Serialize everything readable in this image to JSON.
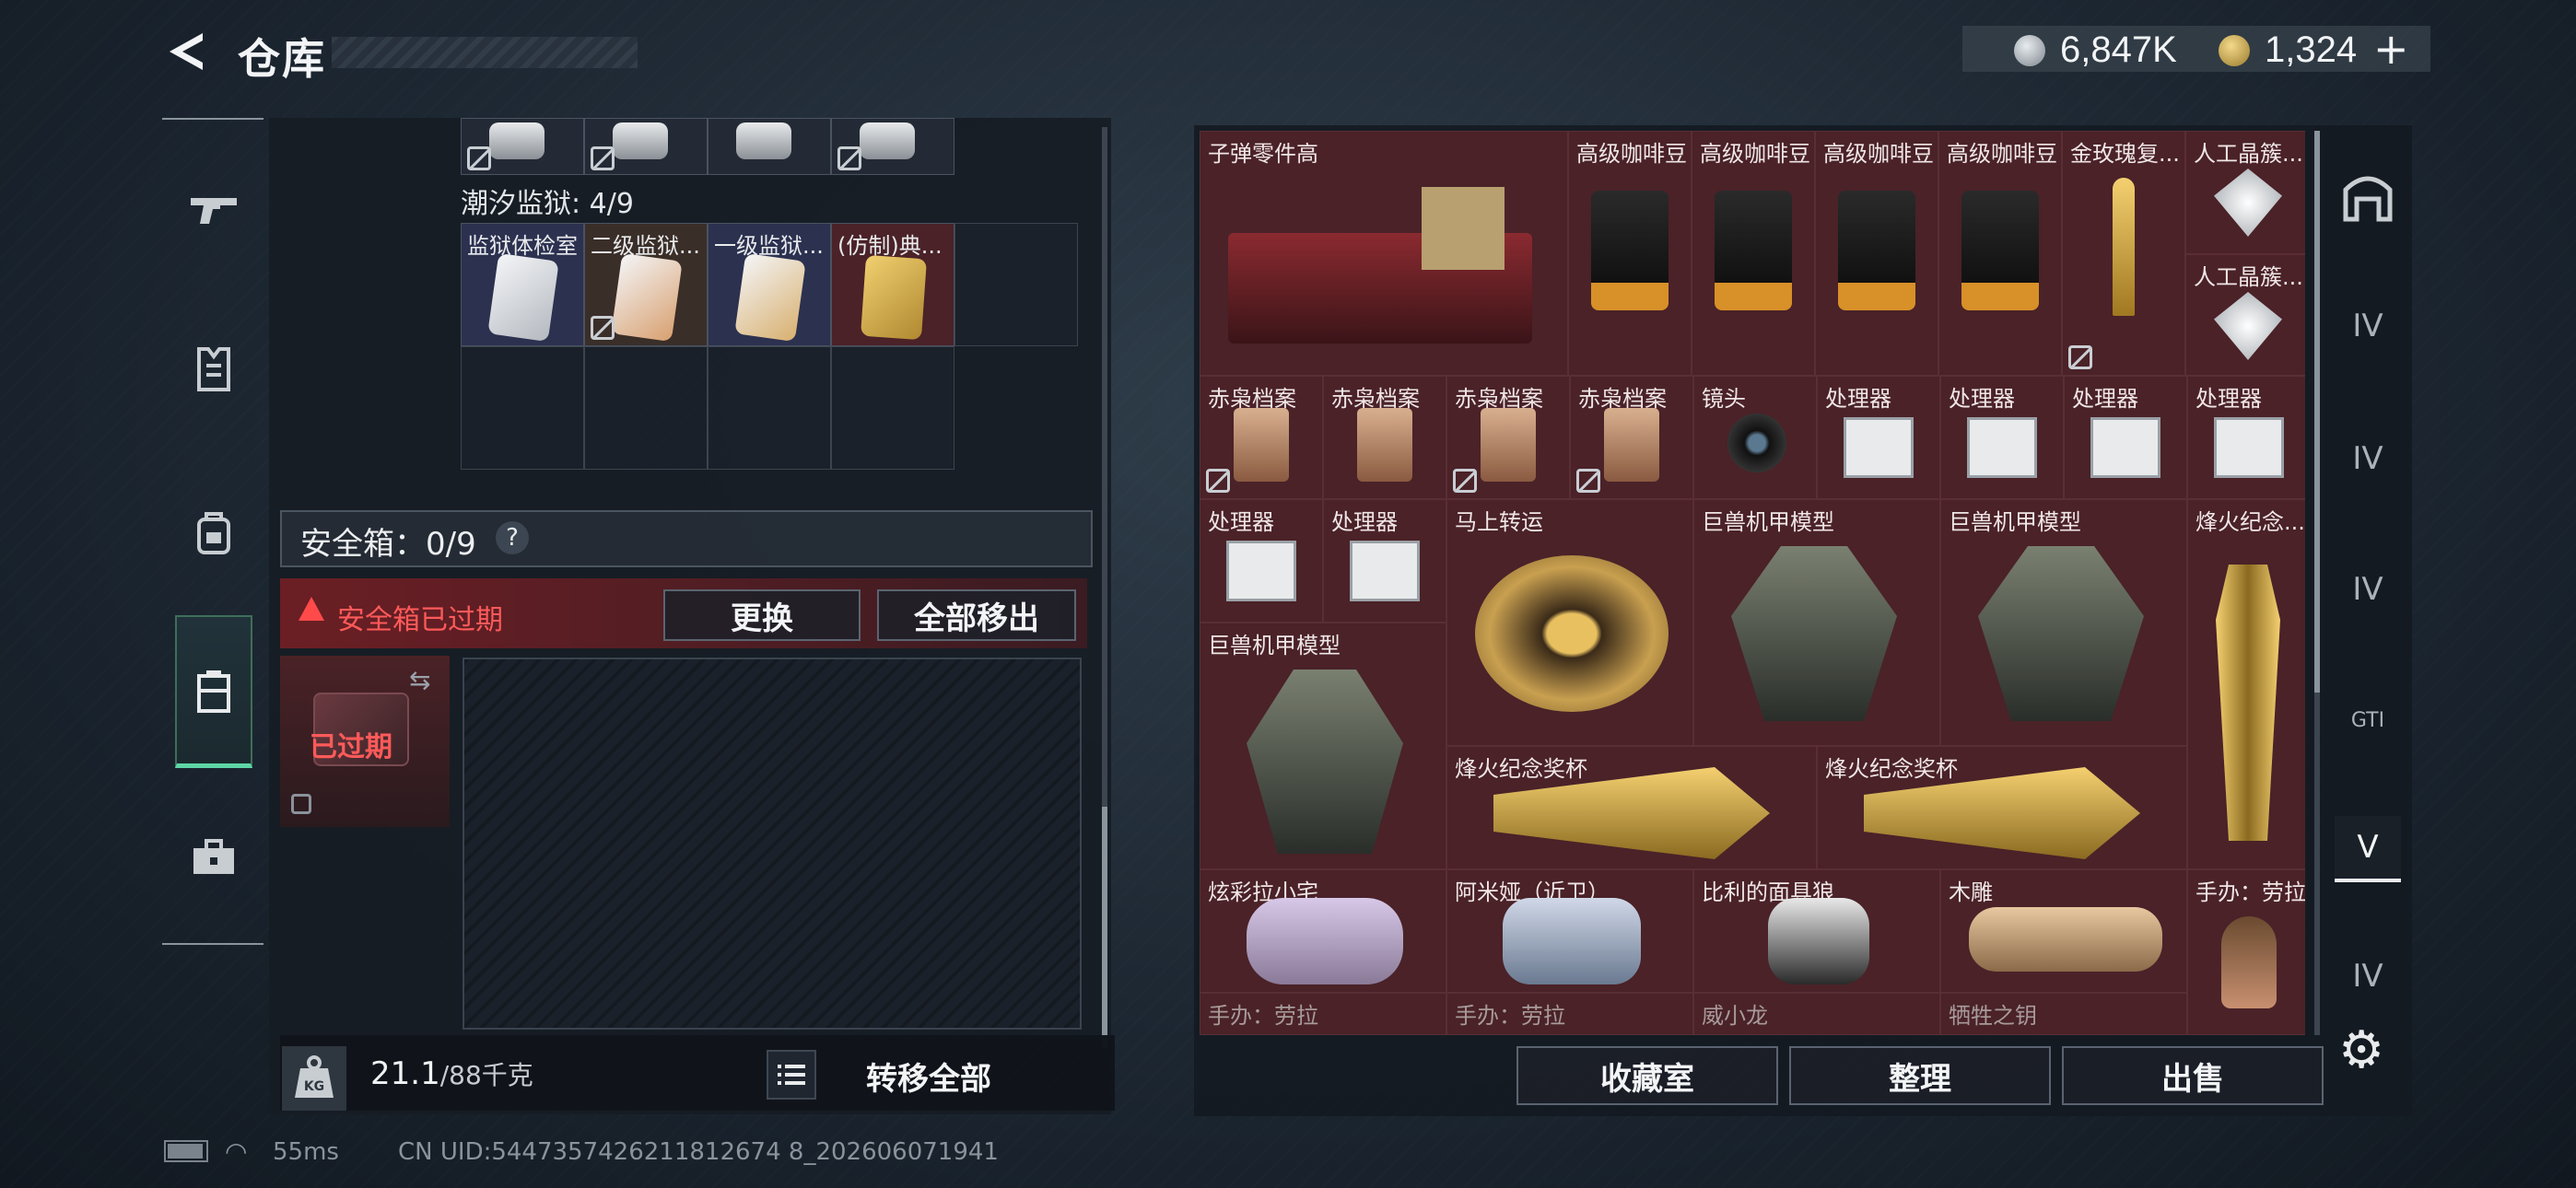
{
  "header": {
    "title": "仓库",
    "currency1": "6,847K",
    "currency2": "1,324",
    "plus": "+"
  },
  "left": {
    "container_label": "潮汐监狱: 4/9",
    "items": [
      "监狱体检室",
      "二级监狱...",
      "一级监狱...",
      "(仿制)典..."
    ],
    "safebox_label": "安全箱：0/9",
    "help": "?",
    "warning": "安全箱已过期",
    "btn_replace": "更换",
    "btn_moveall": "全部移出",
    "expired": "已过期",
    "weight_current": "21.1",
    "weight_max": "/88千克",
    "transfer_all": "转移全部"
  },
  "status": {
    "ping": "55ms",
    "uid": "CN UID:5447357426211812674 8_202606071941"
  },
  "right": {
    "items": [
      "子弹零件高",
      "高级咖啡豆",
      "高级咖啡豆",
      "高级咖啡豆",
      "高级咖啡豆",
      "金玫瑰复...",
      "人工晶簇...",
      "人工晶簇...",
      "赤枭档案",
      "赤枭档案",
      "赤枭档案",
      "赤枭档案",
      "镜头",
      "处理器",
      "处理器",
      "处理器",
      "处理器",
      "处理器",
      "处理器",
      "马上转运",
      "巨兽机甲模型",
      "巨兽机甲模型",
      "烽火纪念...",
      "巨兽机甲模型",
      "烽火纪念奖杯",
      "烽火纪念奖杯",
      "炫彩拉小宅",
      "阿米娅（近卫）",
      "比利的面具狼",
      "木雕",
      "手办：劳拉",
      "手办：劳拉",
      "手办：劳拉",
      "威小龙",
      "牺牲之钥"
    ],
    "btn_collect": "收藏室",
    "btn_sort": "整理",
    "btn_sell": "出售"
  },
  "rightnav": {
    "tab1": "IV",
    "tab2": "IV",
    "tab3": "IV",
    "tab4": "GTI",
    "tab5": "V",
    "tab6": "IV"
  }
}
